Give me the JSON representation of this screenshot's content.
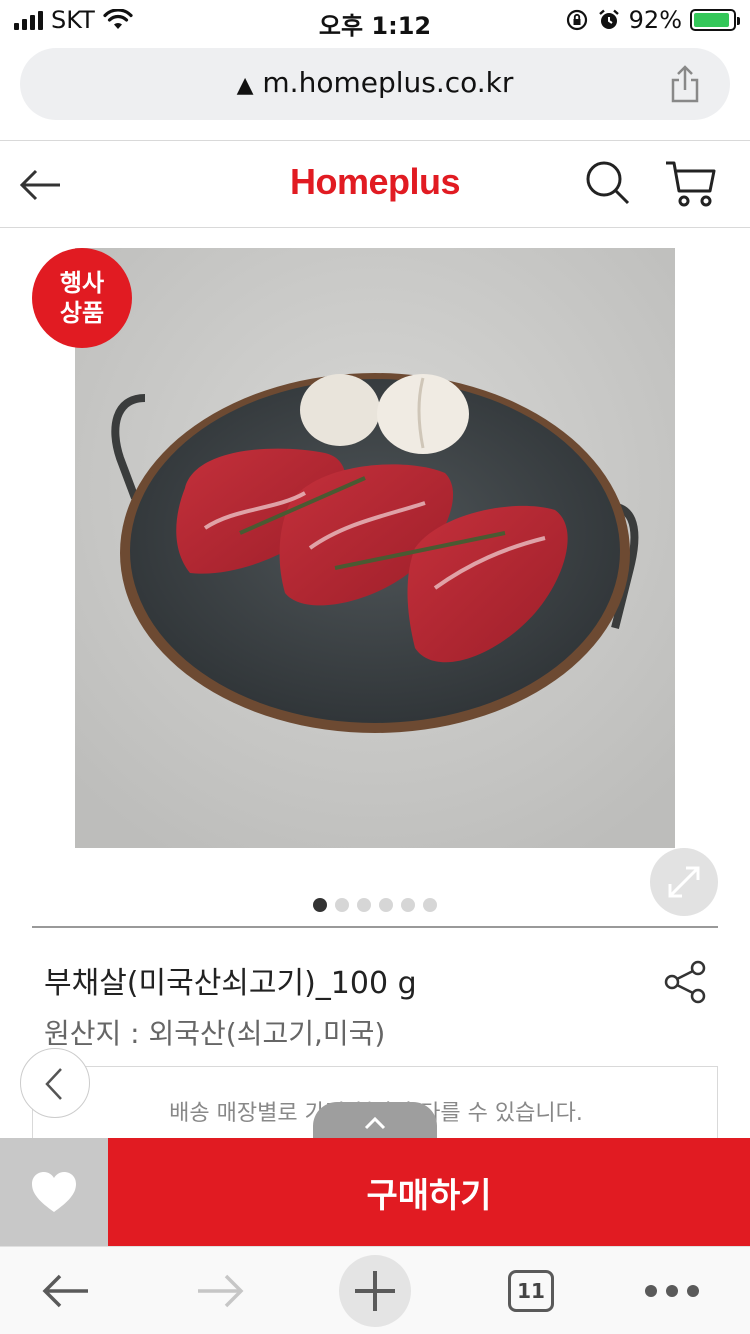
{
  "status_bar": {
    "carrier": "SKT",
    "time": "오후 1:12",
    "battery_percent": "92%",
    "battery_level": 0.92
  },
  "url_bar": {
    "url": "m.homeplus.co.kr"
  },
  "header": {
    "logo": "Homeplus"
  },
  "product": {
    "badge_line1": "행사",
    "badge_line2": "상품",
    "name": "부채살(미국산쇠고기)_100 g",
    "origin": "원산지 : 외국산(쇠고기,미국)",
    "notice": "배송 매장별로 가격/행사가 다를 수 있습니다.",
    "image_count": 6,
    "active_image_index": 0
  },
  "actions": {
    "buy_label": "구매하기"
  },
  "browser_toolbar": {
    "tab_count": "11"
  },
  "colors": {
    "brand": "#e11b22",
    "wish_bg": "#c8c8c8",
    "url_bar_bg": "#eeeff1"
  }
}
